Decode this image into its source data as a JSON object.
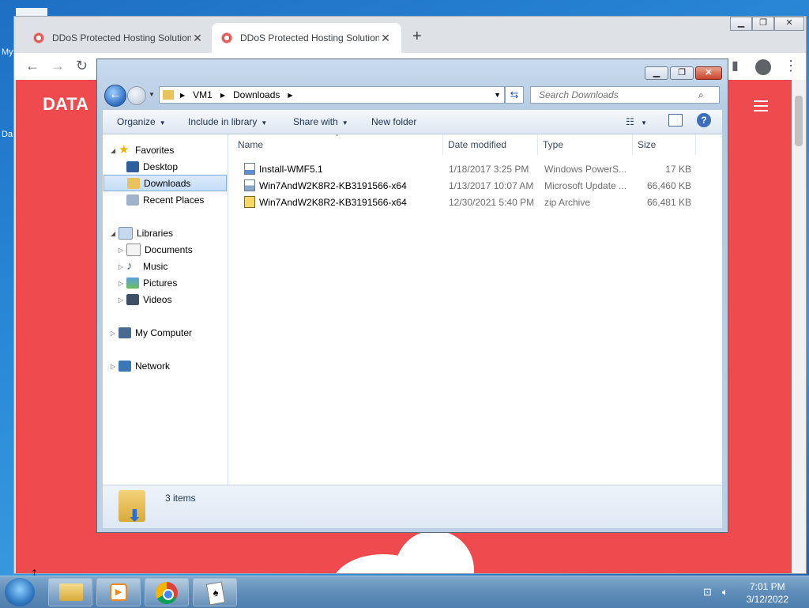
{
  "desktop": {
    "icon_label_1": "My",
    "icon_label_2": "Da"
  },
  "browser": {
    "tabs": [
      {
        "title": "DDoS Protected Hosting Solution"
      },
      {
        "title": "DDoS Protected Hosting Solution"
      }
    ],
    "page": {
      "brand": "DATA"
    }
  },
  "explorer": {
    "breadcrumb": [
      "VM1",
      "Downloads"
    ],
    "search_placeholder": "Search Downloads",
    "commands": [
      "Organize",
      "Include in library",
      "Share with",
      "New folder"
    ],
    "nav": {
      "favorites": "Favorites",
      "desktop": "Desktop",
      "downloads": "Downloads",
      "recent": "Recent Places",
      "libraries": "Libraries",
      "documents": "Documents",
      "music": "Music",
      "pictures": "Pictures",
      "videos": "Videos",
      "computer": "My Computer",
      "network": "Network"
    },
    "columns": [
      "Name",
      "Date modified",
      "Type",
      "Size"
    ],
    "files": [
      {
        "name": "Install-WMF5.1",
        "date": "1/18/2017 3:25 PM",
        "type": "Windows PowerS...",
        "size": "17 KB"
      },
      {
        "name": "Win7AndW2K8R2-KB3191566-x64",
        "date": "1/13/2017 10:07 AM",
        "type": "Microsoft Update ...",
        "size": "66,460 KB"
      },
      {
        "name": "Win7AndW2K8R2-KB3191566-x64",
        "date": "12/30/2021 5:40 PM",
        "type": "zip Archive",
        "size": "66,481 KB"
      }
    ],
    "status": "3 items"
  },
  "taskbar": {
    "time": "7:01 PM",
    "date": "3/12/2022"
  }
}
